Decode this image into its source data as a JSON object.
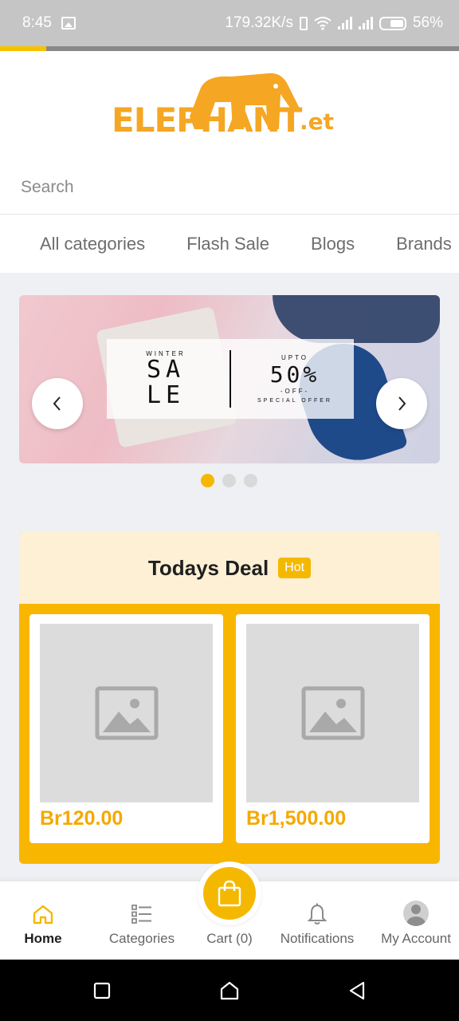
{
  "status_bar": {
    "time": "8:45",
    "net_speed": "179.32K/s",
    "battery": "56%"
  },
  "page_load_progress": 0.1,
  "header": {
    "logo_main": "ELEPHANT",
    "logo_suffix": ".et",
    "search_placeholder": "Search",
    "tabs": [
      "All categories",
      "Flash Sale",
      "Blogs",
      "Brands"
    ]
  },
  "banner": {
    "left_small": "WINTER",
    "left_big_1": "SA",
    "left_big_2": "LE",
    "right_small": "UPTO",
    "right_big": "50%",
    "right_off": "-OFF-",
    "right_offer": "SPECIAL OFFER",
    "slide_count": 3,
    "active_slide": 1
  },
  "todays_deal": {
    "title": "Todays Deal",
    "badge": "Hot",
    "products": [
      {
        "price": "Br120.00"
      },
      {
        "price": "Br1,500.00"
      }
    ]
  },
  "bottom_nav": {
    "home": "Home",
    "categories": "Categories",
    "cart": "Cart (0)",
    "notifications": "Notifications",
    "account": "My Account"
  },
  "colors": {
    "accent": "#f5b800",
    "deal_header_bg": "#fdf0d5",
    "price": "#f5a800"
  }
}
